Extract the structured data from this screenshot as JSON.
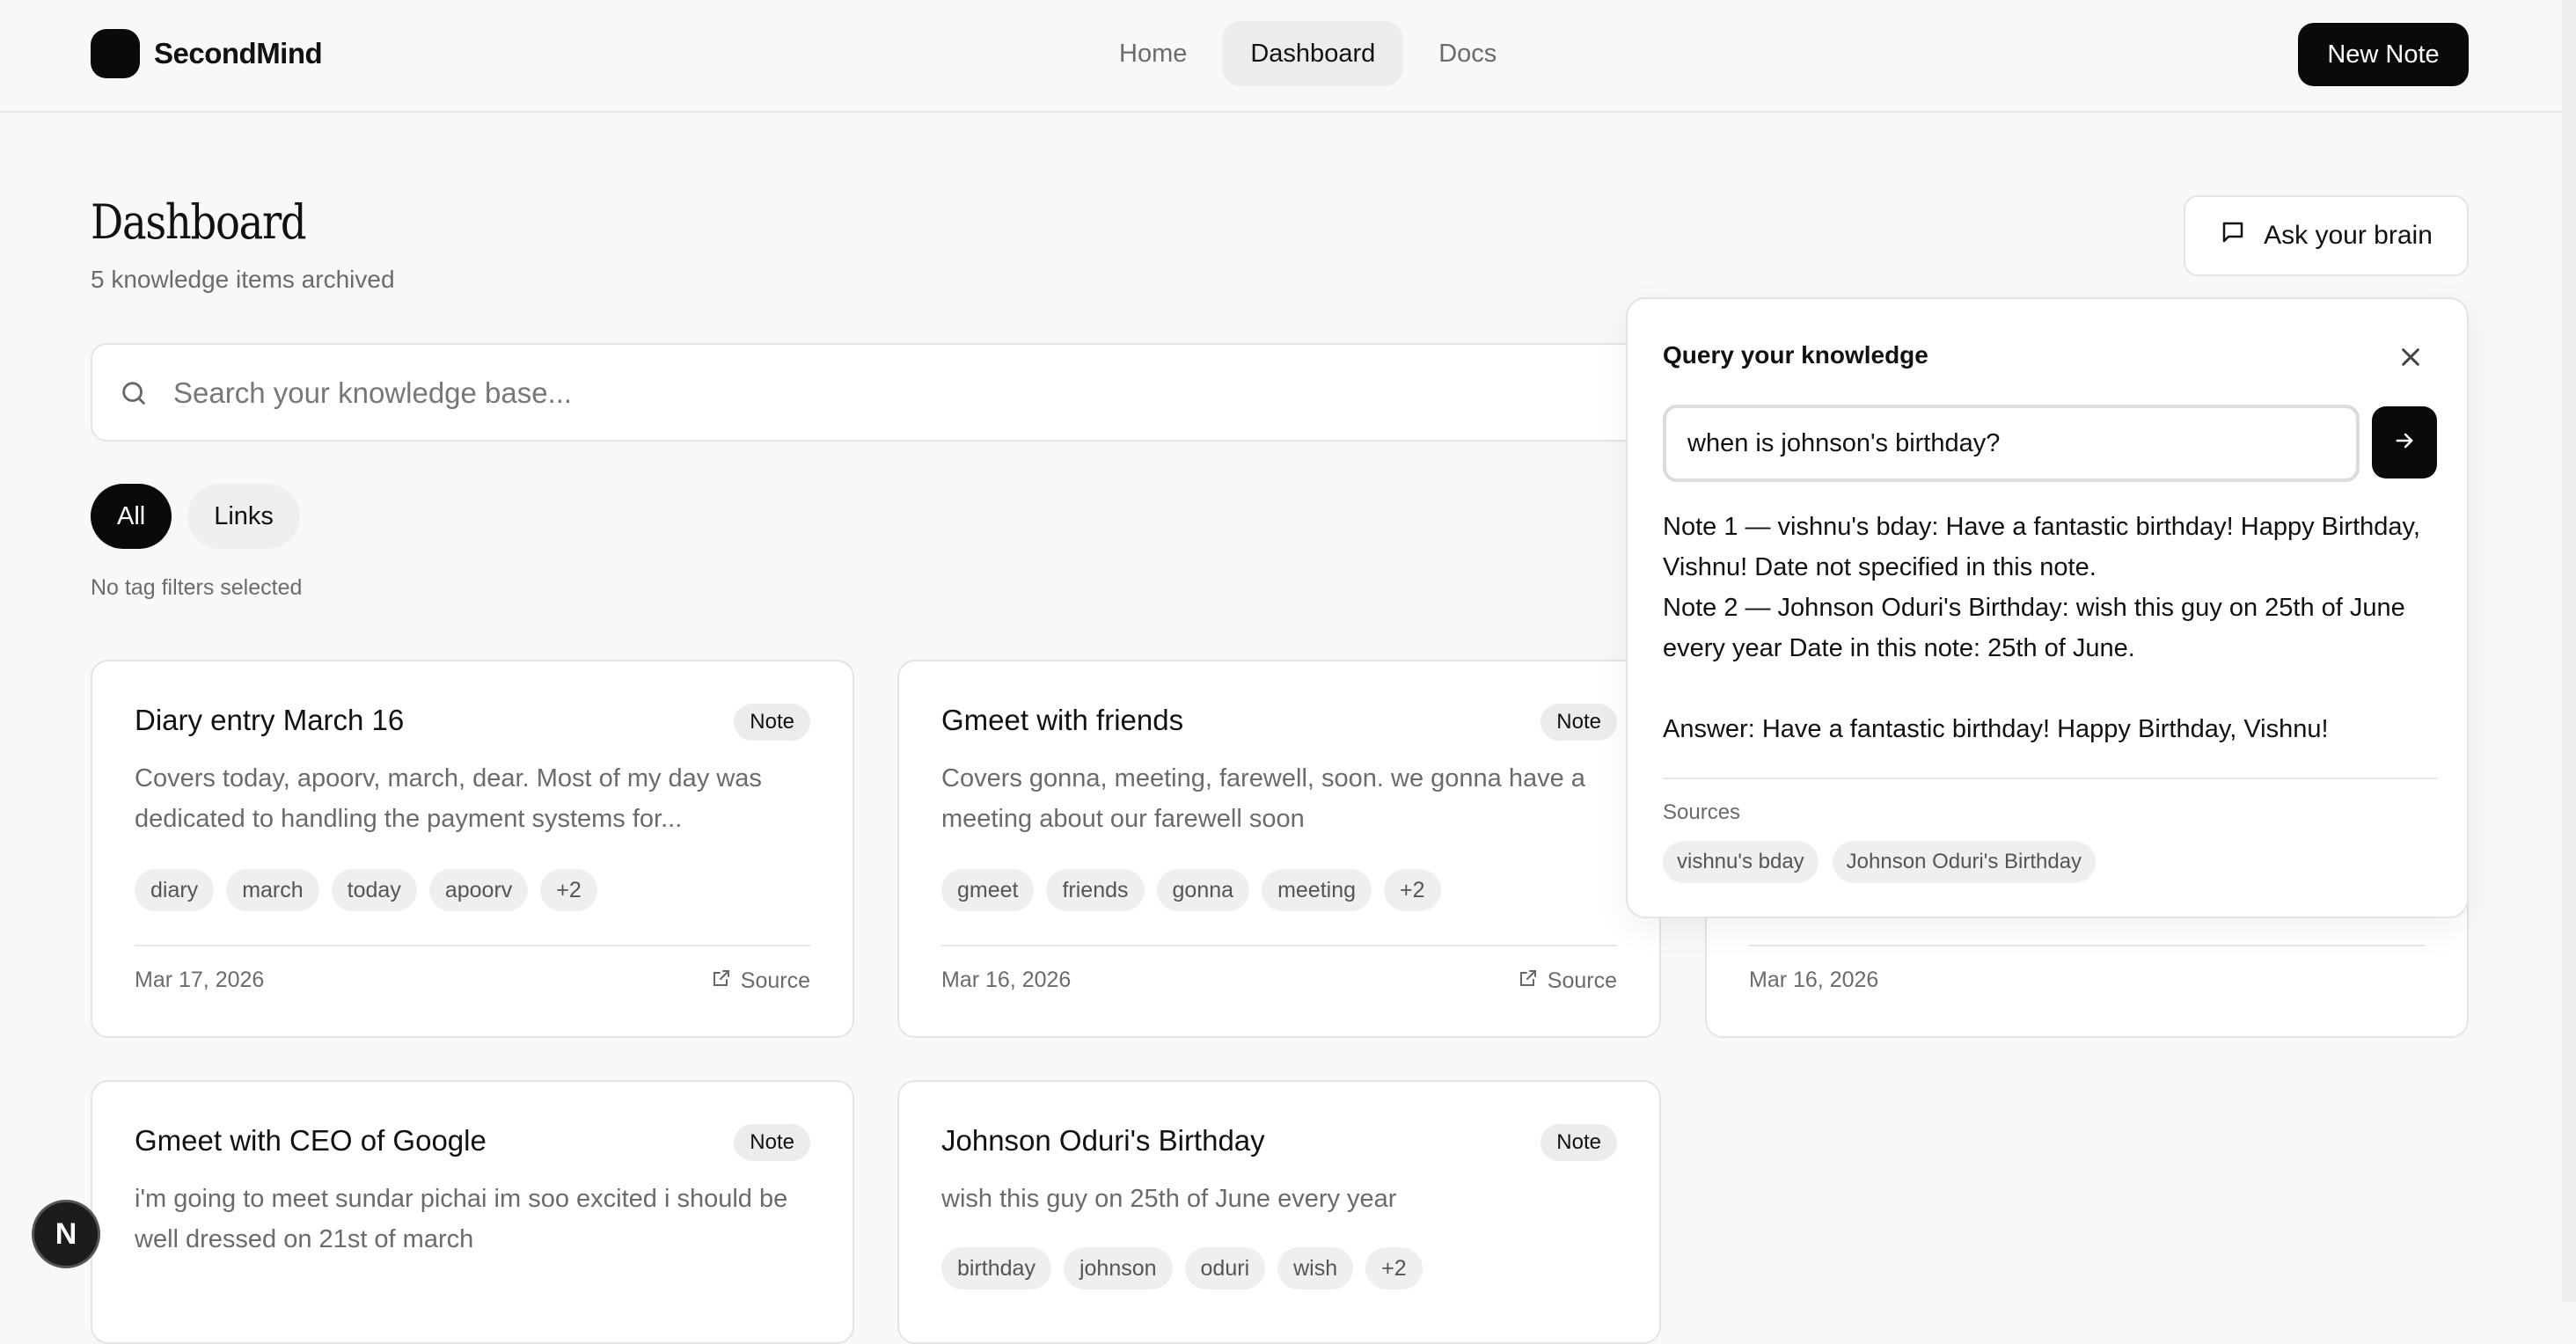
{
  "app": {
    "brand": "SecondMind"
  },
  "nav": {
    "items": [
      {
        "label": "Home",
        "active": false
      },
      {
        "label": "Dashboard",
        "active": true
      },
      {
        "label": "Docs",
        "active": false
      }
    ],
    "new_note_label": "New Note"
  },
  "header": {
    "title": "Dashboard",
    "subtitle": "5 knowledge items archived",
    "ask_label": "Ask your brain"
  },
  "search": {
    "placeholder": "Search your knowledge base...",
    "value": ""
  },
  "filters": {
    "chips": [
      {
        "label": "All",
        "active": true
      },
      {
        "label": "Links",
        "active": false
      }
    ],
    "note": "No tag filters selected"
  },
  "cards": [
    {
      "title": "Diary entry March 16",
      "badge": "Note",
      "desc": "Covers today, apoorv, march, dear. Most of my day was dedicated to handling the payment systems for...",
      "tags": [
        "diary",
        "march",
        "today",
        "apoorv",
        "+2"
      ],
      "date": "Mar 17, 2026",
      "source": "Source"
    },
    {
      "title": "Gmeet with friends",
      "badge": "Note",
      "desc": "Covers gonna, meeting, farewell, soon. we gonna have a meeting about our farewell soon",
      "tags": [
        "gmeet",
        "friends",
        "gonna",
        "meeting",
        "+2"
      ],
      "date": "Mar 16, 2026",
      "source": "Source"
    },
    {
      "date": "Mar 16, 2026"
    },
    {
      "title": "Gmeet with CEO of Google",
      "badge": "Note",
      "desc": "i'm going to meet sundar pichai im soo excited i should be well dressed on 21st of march"
    },
    {
      "title": "Johnson Oduri's Birthday",
      "badge": "Note",
      "desc": "wish this guy on 25th of June every year",
      "tags": [
        "birthday",
        "johnson",
        "oduri",
        "wish",
        "+2"
      ]
    }
  ],
  "query_panel": {
    "title": "Query your knowledge",
    "input_value": "when is johnson's birthday?",
    "answer_lines": [
      "Note 1 — vishnu's bday: Have a fantastic birthday! Happy Birthday, Vishnu! Date not specified in this note.",
      "Note 2 — Johnson Oduri's Birthday: wish this guy on 25th of June every year Date in this note: 25th of June.",
      "Answer: Have a fantastic birthday! Happy Birthday, Vishnu!"
    ],
    "sources_label": "Sources",
    "sources": [
      "vishnu's bday",
      "Johnson Oduri's Birthday"
    ]
  },
  "dev_badge": {
    "letter": "N"
  },
  "icons": {
    "search": "search-icon",
    "chat": "message-square-icon",
    "close": "close-icon",
    "send": "arrow-right-icon",
    "external": "external-link-icon"
  }
}
